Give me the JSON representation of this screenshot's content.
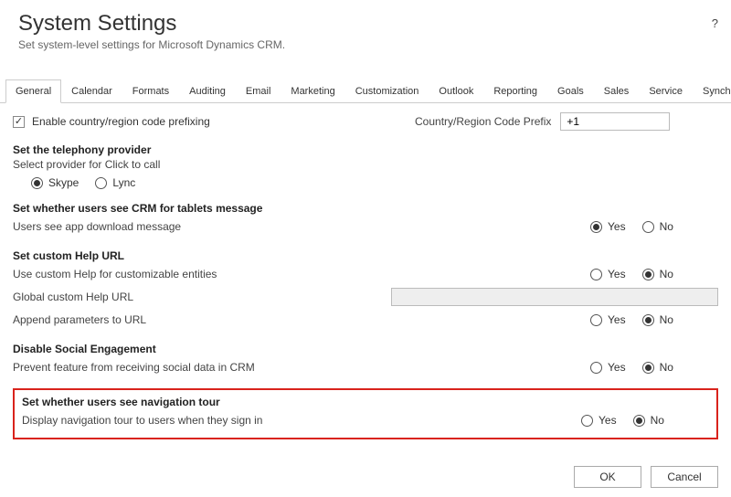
{
  "header": {
    "title": "System Settings",
    "subtitle": "Set system-level settings for Microsoft Dynamics CRM.",
    "help_tooltip": "?"
  },
  "tabs": {
    "items": [
      "General",
      "Calendar",
      "Formats",
      "Auditing",
      "Email",
      "Marketing",
      "Customization",
      "Outlook",
      "Reporting",
      "Goals",
      "Sales",
      "Service",
      "Synchronization"
    ],
    "active": "General"
  },
  "general": {
    "enable_prefix_label": "Enable country/region code prefixing",
    "enable_prefix_checked": true,
    "prefix_label": "Country/Region Code Prefix",
    "prefix_value": "+1"
  },
  "telephony": {
    "title": "Set the telephony provider",
    "sub": "Select provider for Click to call",
    "options": [
      "Skype",
      "Lync"
    ],
    "selected": "Skype"
  },
  "tablets": {
    "title": "Set whether users see CRM for tablets message",
    "row_label": "Users see app download message",
    "selected": "Yes"
  },
  "help": {
    "title": "Set custom Help URL",
    "row1_label": "Use custom Help for customizable entities",
    "row1_selected": "No",
    "row2_label": "Global custom Help URL",
    "row2_value": "",
    "row3_label": "Append parameters to URL",
    "row3_selected": "No"
  },
  "social": {
    "title": "Disable Social Engagement",
    "row_label": "Prevent feature from receiving social data in CRM",
    "selected": "No"
  },
  "navtour": {
    "title": "Set whether users see navigation tour",
    "row_label": "Display navigation tour to users when they sign in",
    "selected": "No"
  },
  "yesno": {
    "yes": "Yes",
    "no": "No"
  },
  "footer": {
    "ok": "OK",
    "cancel": "Cancel"
  }
}
